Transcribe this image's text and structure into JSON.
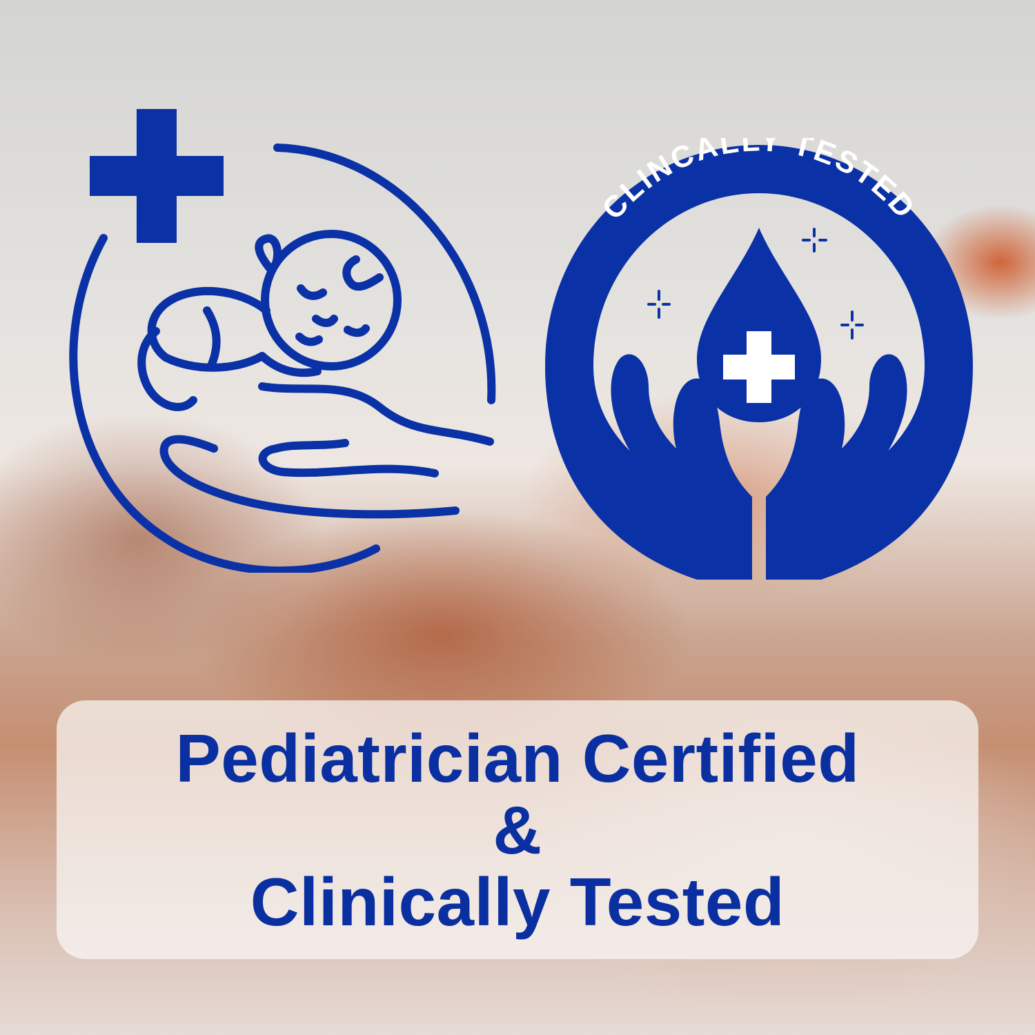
{
  "colors": {
    "brand_blue": "#0a31a5",
    "panel_bg": "#f8f6f5"
  },
  "icons": {
    "pediatrician": "baby-in-hand-icon",
    "clinical": "clinically-tested-badge-icon"
  },
  "badge": {
    "arc_text": "CLINCALLY TESTED"
  },
  "headline": {
    "line1": "Pediatrician Certified",
    "line2": "&",
    "line3": "Clinically Tested"
  }
}
